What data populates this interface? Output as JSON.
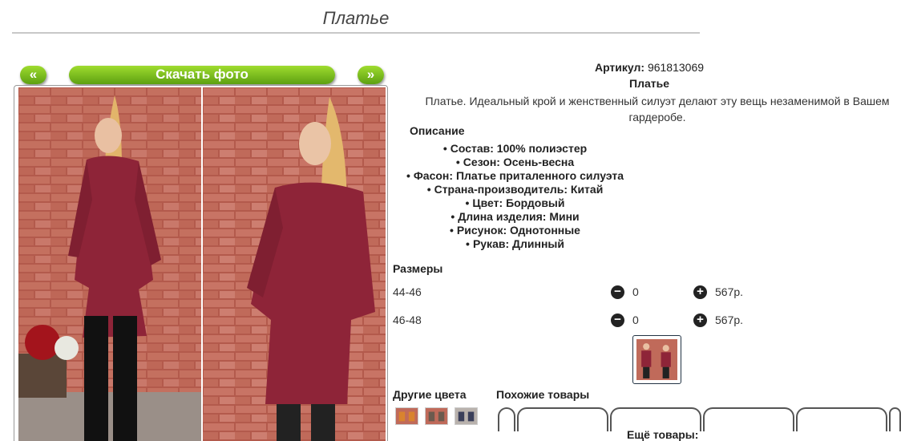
{
  "page": {
    "title": "Платье"
  },
  "gallery": {
    "prev_label": "«",
    "next_label": "»",
    "download_label": "Скачать фото"
  },
  "product": {
    "article_label": "Артикул:",
    "article_value": "961813069",
    "name": "Платье",
    "description": "Платье. Идеальный крой и женственный силуэт делают эту вещь незаменимой в Вашем гардеробе.",
    "description_heading": "Описание",
    "features": [
      "Состав: 100% полиэстер",
      "Сезон: Осень-весна",
      "Фасон: Платье приталенного силуэта",
      "Страна-производитель: Китай",
      "Цвет: Бордовый",
      "Длина изделия: Мини",
      "Рисунок: Однотонные",
      "Рукав: Длинный"
    ]
  },
  "sizes": {
    "heading": "Размеры",
    "rows": [
      {
        "size": "44-46",
        "qty": "0",
        "price": "567р."
      },
      {
        "size": "46-48",
        "qty": "0",
        "price": "567р."
      }
    ]
  },
  "related": {
    "other_colors_label": "Другие цвета",
    "similar_label": "Похожие товары",
    "more_label": "Ещё товары:"
  },
  "colors": {
    "dress": "#8e2438",
    "brick": "#b5564a",
    "button_green": "#6fb51c"
  }
}
